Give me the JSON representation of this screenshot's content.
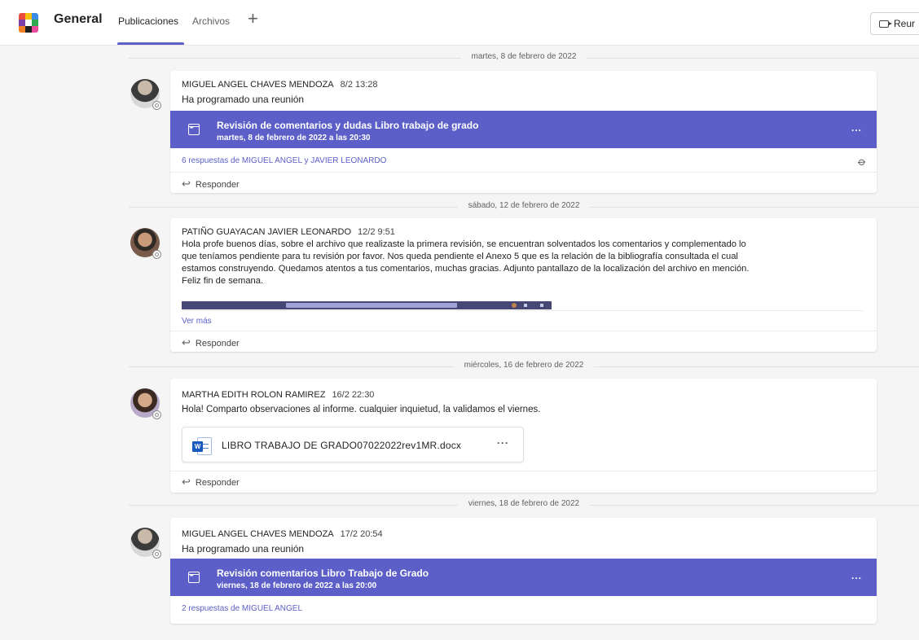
{
  "header": {
    "channel_title": "General",
    "tabs": [
      {
        "label": "Publicaciones",
        "active": true
      },
      {
        "label": "Archivos",
        "active": false
      }
    ],
    "add_tab_icon": "plus-icon",
    "meet_button": "Reur"
  },
  "colors": {
    "accent": "#5b5fc7",
    "background": "#f5f5f5"
  },
  "posts": [
    {
      "date_separator": "martes, 8 de febrero de 2022",
      "author": "MIGUEL ANGEL CHAVES MENDOZA",
      "time": "8/2 13:28",
      "body": "Ha programado una reunión",
      "meeting": {
        "title": "Revisión de comentarios y dudas Libro trabajo de grado",
        "subtitle": "martes, 8 de febrero de 2022 a las 20:30",
        "more": "..."
      },
      "replies": "6 respuestas de MIGUEL ANGEL y JAVIER LEONARDO",
      "reply_label": "Responder"
    },
    {
      "date_separator": "sábado, 12 de febrero de 2022",
      "author": "PATIÑO GUAYACAN JAVIER LEONARDO",
      "time": "12/2 9:51",
      "body_lines": [
        "Hola profe buenos días, sobre el archivo que realizaste la primera revisión, se encuentran solventados los comentarios y complementado lo",
        "que teníamos pendiente para tu revisión por favor. Nos queda pendiente el Anexo 5 que es la relación de la bibliografía consultada el cual",
        "estamos construyendo. Quedamos atentos a tus comentarios, muchas gracias. Adjunto pantallazo de la localización del archivo en mención.",
        "Feliz fin de semana."
      ],
      "see_more": "Ver más",
      "reply_label": "Responder"
    },
    {
      "date_separator": "miércoles, 16 de febrero de 2022",
      "author": "MARTHA EDITH ROLON RAMIREZ",
      "time": "16/2 22:30",
      "body": "Hola! Comparto observaciones al informe. cualquier inquietud, la validamos el viernes.",
      "file": {
        "name": "LIBRO TRABAJO DE GRADO07022022rev1MR.docx",
        "more": "···",
        "icon": "word-file-icon"
      },
      "reply_label": "Responder"
    },
    {
      "date_separator": "viernes, 18 de febrero de 2022",
      "author": "MIGUEL ANGEL CHAVES MENDOZA",
      "time": "17/2 20:54",
      "body": "Ha programado una reunión",
      "meeting": {
        "title": "Revisión comentarios Libro Trabajo de Grado",
        "subtitle": "viernes, 18 de febrero de 2022 a las 20:00",
        "more": "..."
      },
      "replies": "2 respuestas de MIGUEL ANGEL"
    }
  ]
}
